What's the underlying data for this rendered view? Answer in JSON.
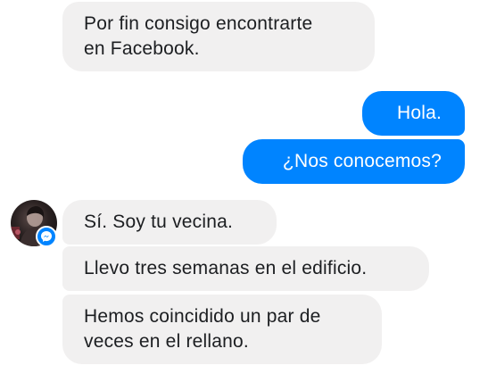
{
  "conversation": {
    "messages": [
      {
        "direction": "incoming",
        "lines": [
          "Por fin consigo encontrarte",
          "en Facebook."
        ]
      },
      {
        "direction": "outgoing",
        "lines": [
          "Hola."
        ]
      },
      {
        "direction": "outgoing",
        "lines": [
          "¿Nos conocemos?"
        ]
      },
      {
        "direction": "incoming",
        "lines": [
          "Sí. Soy tu vecina."
        ]
      },
      {
        "direction": "incoming",
        "lines": [
          "Llevo tres semanas en el edificio."
        ]
      },
      {
        "direction": "incoming",
        "lines": [
          "Hemos coincidido un par de",
          "veces en el rellano."
        ]
      }
    ]
  },
  "contact": {
    "avatar_icon": "profile-photo",
    "badge_icon": "messenger-icon"
  },
  "colors": {
    "outgoing_bubble": "#0084ff",
    "incoming_bubble": "#f1f0f0",
    "incoming_text": "#1c1e21",
    "outgoing_text": "#ffffff"
  }
}
